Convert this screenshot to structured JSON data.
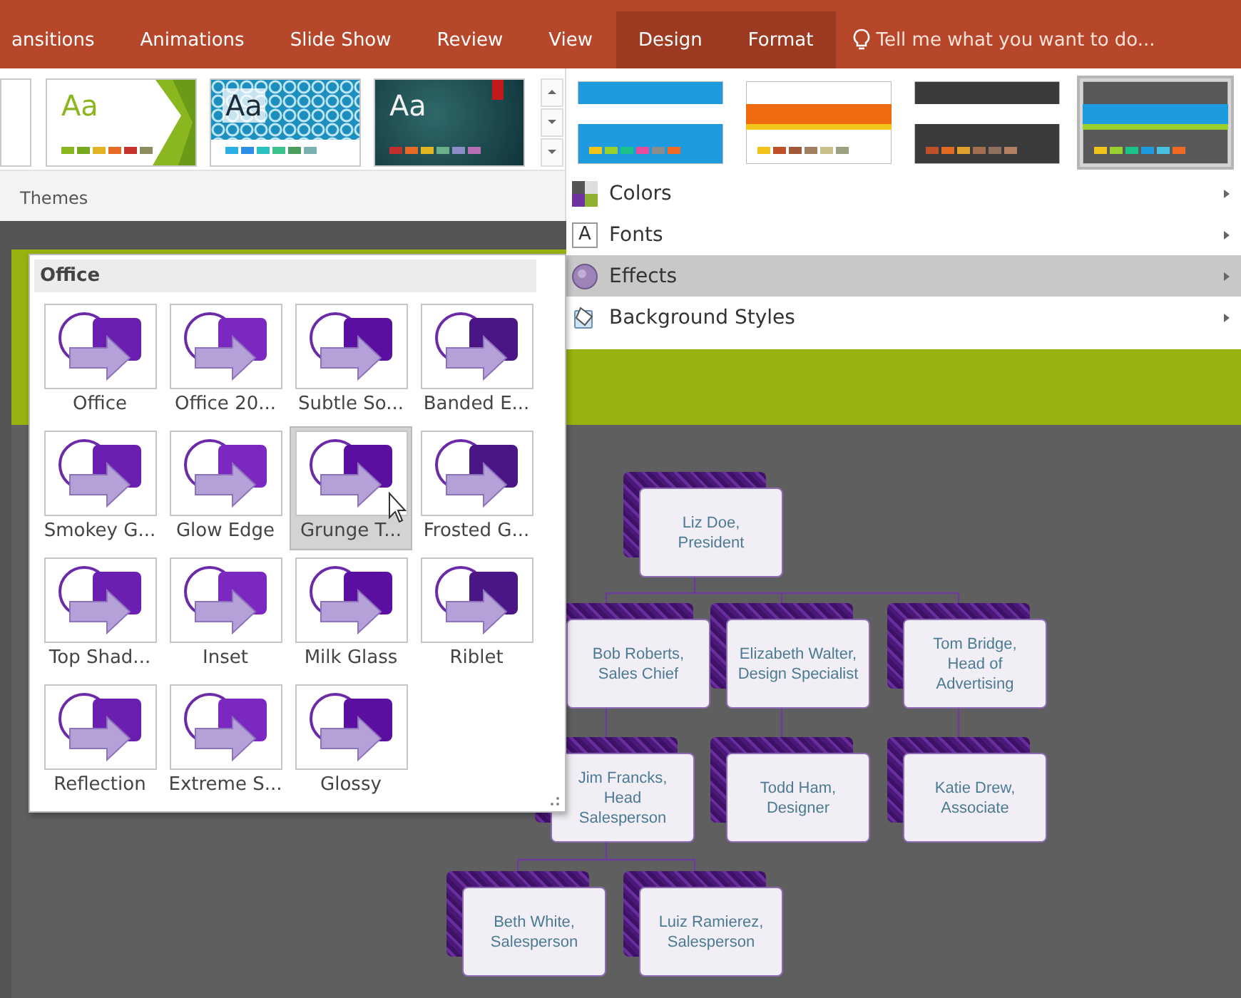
{
  "tabs": [
    {
      "label": "ansitions",
      "contextual": false
    },
    {
      "label": "Animations",
      "contextual": false
    },
    {
      "label": "Slide Show",
      "contextual": false
    },
    {
      "label": "Review",
      "contextual": false
    },
    {
      "label": "View",
      "contextual": false
    },
    {
      "label": "Design",
      "contextual": true
    },
    {
      "label": "Format",
      "contextual": true
    }
  ],
  "tell_me": {
    "placeholder": "Tell me what you want to do..."
  },
  "themes": {
    "label": "Themes",
    "items": [
      {
        "kind": "partial"
      },
      {
        "kind": "green",
        "text": "Aa"
      },
      {
        "kind": "pattern",
        "text": "Aa"
      },
      {
        "kind": "teal",
        "text": "Aa"
      }
    ]
  },
  "variants": [
    {
      "kind": "blue",
      "selected": false
    },
    {
      "kind": "orange",
      "selected": false
    },
    {
      "kind": "dark",
      "selected": false
    },
    {
      "kind": "grey",
      "selected": true
    }
  ],
  "design_menu": [
    {
      "kind": "colors",
      "label": "Colors",
      "selected": false
    },
    {
      "kind": "fonts",
      "icon_text": "A",
      "label": "Fonts",
      "selected": false
    },
    {
      "kind": "effects",
      "label": "Effects",
      "selected": true
    },
    {
      "kind": "background",
      "label": "Background Styles",
      "selected": false
    }
  ],
  "effects_gallery": {
    "heading": "Office",
    "items": [
      {
        "label": "Office",
        "selected": false
      },
      {
        "label": "Office 20...",
        "selected": false
      },
      {
        "label": "Subtle So...",
        "selected": false
      },
      {
        "label": "Banded E...",
        "selected": false
      },
      {
        "label": "Smokey G...",
        "selected": false
      },
      {
        "label": "Glow Edge",
        "selected": false
      },
      {
        "label": "Grunge T...",
        "selected": true
      },
      {
        "label": "Frosted G...",
        "selected": false
      },
      {
        "label": "Top Shad...",
        "selected": false
      },
      {
        "label": "Inset",
        "selected": false
      },
      {
        "label": "Milk Glass",
        "selected": false
      },
      {
        "label": "Riblet",
        "selected": false
      },
      {
        "label": "Reflection",
        "selected": false
      },
      {
        "label": "Extreme S...",
        "selected": false
      },
      {
        "label": "Glossy",
        "selected": false
      }
    ]
  },
  "org_chart": {
    "root": {
      "text": "Liz Doe,\nPresident",
      "children": [
        {
          "text": "Bob Roberts,\nSales Chief",
          "children": [
            {
              "text": "Jim Francks,\nHead\nSalesperson",
              "children": [
                {
                  "text": "Beth White,\nSalesperson"
                },
                {
                  "text": "Luiz Ramierez,\nSalesperson"
                }
              ]
            }
          ]
        },
        {
          "text": "Elizabeth Walter,\nDesign Specialist",
          "children": [
            {
              "text": "Todd Ham,\nDesigner"
            }
          ]
        },
        {
          "text": "Tom Bridge,\nHead of\nAdvertising",
          "children": [
            {
              "text": "Katie Drew,\nAssociate"
            }
          ]
        }
      ]
    }
  }
}
